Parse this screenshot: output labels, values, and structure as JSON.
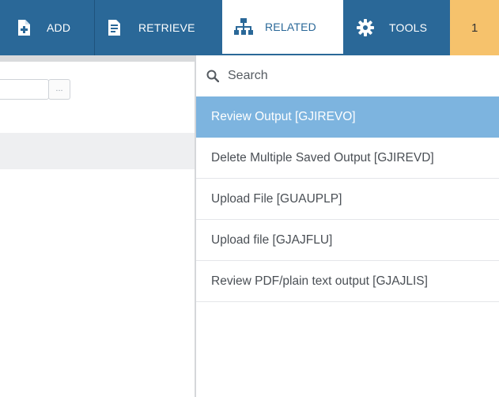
{
  "toolbar": {
    "add_label": "ADD",
    "retrieve_label": "RETRIEVE",
    "related_label": "RELATED",
    "tools_label": "TOOLS",
    "notification_count": "1",
    "icons": {
      "add": "add-document-icon",
      "retrieve": "retrieve-document-icon",
      "related": "hierarchy-icon",
      "tools": "gear-icon"
    },
    "colors": {
      "bar": "#2a6898",
      "count_badge": "#f6c26c"
    }
  },
  "left_pane": {
    "lookup_label": "..."
  },
  "related_menu": {
    "search": {
      "placeholder": "Search",
      "icon": "search-icon"
    },
    "items": [
      {
        "label": "Review Output [GJIREVO]",
        "active": true
      },
      {
        "label": "Delete Multiple Saved Output [GJIREVD]",
        "active": false
      },
      {
        "label": "Upload File [GUAUPLP]",
        "active": false
      },
      {
        "label": "Upload file [GJAJFLU]",
        "active": false
      },
      {
        "label": "Review PDF/plain text output [GJAJLIS]",
        "active": false
      }
    ],
    "active_color": "#7db4df"
  }
}
